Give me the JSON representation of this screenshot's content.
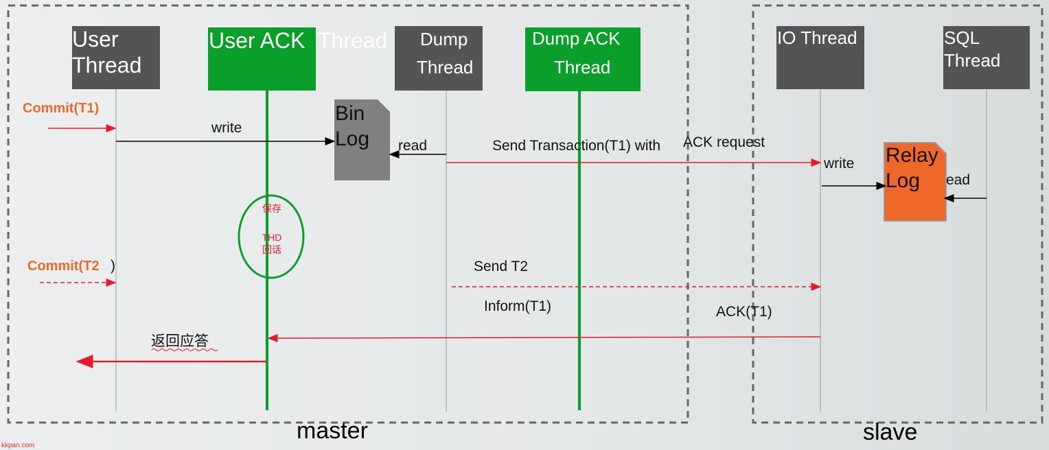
{
  "threads": {
    "user": "User",
    "user2": "Thread",
    "user_ack": "User ACK",
    "user_ack2": "Thread",
    "dump": "Dump",
    "dump2": "Thread",
    "dump_ack": "Dump  ACK",
    "dump_ack2": "Thread",
    "io": "IO Thread",
    "sql": "SQL",
    "sql2": "Thread"
  },
  "docs": {
    "binlog1": "Bin",
    "binlog2": "Log",
    "relay1": "Relay",
    "relay2": "Log"
  },
  "messages": {
    "commit_t1": "Commit(T1)",
    "write1": "write",
    "read1": "read",
    "send_t1": "Send Transaction(T1) with",
    "ack_request": "ACK request",
    "write2": "write",
    "read2": "ead",
    "commit_t2": "Commit(T2",
    "commit_t2_paren": ")",
    "send_t2": "Send  T2",
    "inform_t1": "Inform(T1)",
    "ack_t1": "ACK(T1)",
    "reply": "返回应答"
  },
  "ellipse": {
    "line1": "保存",
    "line2": "THD",
    "line3": "回话"
  },
  "groups": {
    "master": "master",
    "slave": "slave"
  },
  "watermark": "kkpan.com",
  "colors": {
    "thread": "#545454",
    "ack_thread": "#0a9e2a",
    "arrow_red": "#e8192c",
    "commit_orange": "#ee6a2c",
    "binlog": "#808080",
    "relaylog": "#f0672a"
  }
}
